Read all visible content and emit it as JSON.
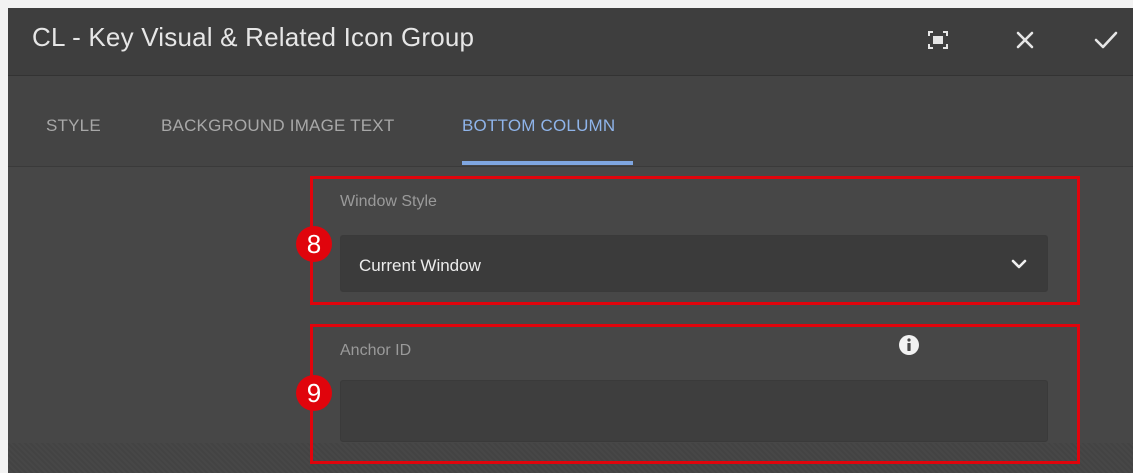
{
  "dialog": {
    "title": "CL - Key Visual & Related Icon Group",
    "buttons": {
      "fullscreen_icon": "fullscreen-icon",
      "close_icon": "close-icon",
      "confirm_icon": "checkmark-icon"
    }
  },
  "tabs": [
    {
      "label": "STYLE",
      "active": false
    },
    {
      "label": "BACKGROUND IMAGE TEXT",
      "active": false
    },
    {
      "label": "BOTTOM COLUMN",
      "active": true
    }
  ],
  "fields": {
    "window_style": {
      "label": "Window Style",
      "value": "Current Window"
    },
    "anchor_id": {
      "label": "Anchor ID",
      "value": "",
      "info_icon": "info-icon"
    }
  },
  "annotations": [
    {
      "number": "8"
    },
    {
      "number": "9"
    }
  ],
  "colors": {
    "highlight": "#e0040c",
    "active_tab": "#8fb4ea"
  }
}
